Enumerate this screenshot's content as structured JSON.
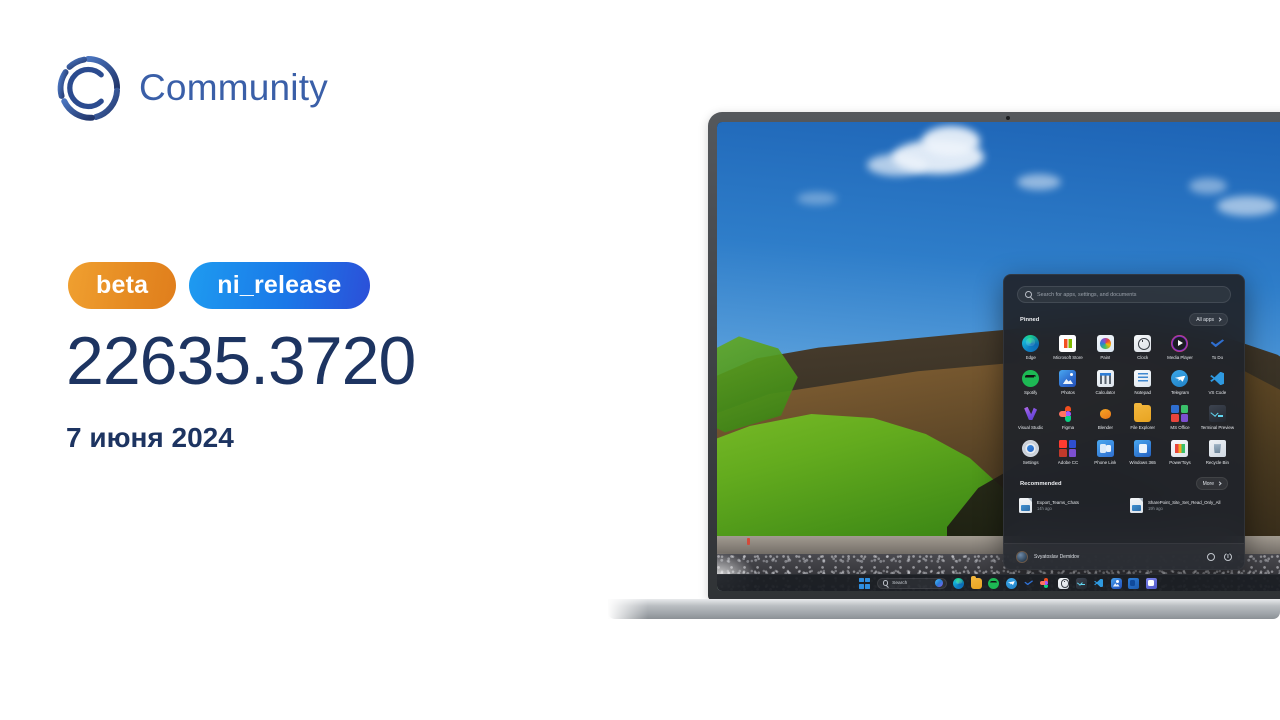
{
  "brand": {
    "name": "Community",
    "mark": "community-logo",
    "color": "#3a5fa8"
  },
  "release": {
    "badges": [
      {
        "label": "beta",
        "kind": "ring",
        "color": "#e58a22"
      },
      {
        "label": "ni_release",
        "kind": "branch",
        "color": "#1a78e8"
      }
    ],
    "build_number": "22635.3720",
    "date": "7 июня 2024",
    "text_color": "#1d3461"
  },
  "start_menu": {
    "search": {
      "placeholder": "Search for apps, settings, and documents",
      "icon": "search-icon"
    },
    "pinned": {
      "title": "Pinned",
      "all_apps_label": "All apps",
      "apps": [
        {
          "label": "Edge",
          "icon": "edge-icon"
        },
        {
          "label": "Microsoft Store",
          "icon": "microsoft-store-icon"
        },
        {
          "label": "Paint",
          "icon": "paint-icon"
        },
        {
          "label": "Clock",
          "icon": "clock-icon"
        },
        {
          "label": "Media Player",
          "icon": "media-player-icon"
        },
        {
          "label": "To Do",
          "icon": "to-do-icon"
        },
        {
          "label": "Spotify",
          "icon": "spotify-icon"
        },
        {
          "label": "Photos",
          "icon": "photos-icon"
        },
        {
          "label": "Calculator",
          "icon": "calculator-icon"
        },
        {
          "label": "Notepad",
          "icon": "notepad-icon"
        },
        {
          "label": "Telegram",
          "icon": "telegram-icon"
        },
        {
          "label": "VS Code",
          "icon": "vs-code-icon"
        },
        {
          "label": "Visual Studio",
          "icon": "visual-studio-icon"
        },
        {
          "label": "Figma",
          "icon": "figma-icon"
        },
        {
          "label": "Blender",
          "icon": "blender-icon"
        },
        {
          "label": "File Explorer",
          "icon": "file-explorer-icon"
        },
        {
          "label": "MS Office",
          "icon": "ms-office-icon"
        },
        {
          "label": "Terminal Preview",
          "icon": "terminal-preview-icon"
        },
        {
          "label": "Settings",
          "icon": "settings-icon"
        },
        {
          "label": "Adobe CC",
          "icon": "adobe-cc-icon"
        },
        {
          "label": "Phone Link",
          "icon": "phone-link-icon"
        },
        {
          "label": "Windows 365",
          "icon": "windows-365-icon"
        },
        {
          "label": "PowerToys",
          "icon": "powertoys-icon"
        },
        {
          "label": "Recycle Bin",
          "icon": "recycle-bin-icon"
        }
      ]
    },
    "recommended": {
      "title": "Recommended",
      "more_label": "More",
      "items": [
        {
          "name": "Export_Teams_Chats",
          "time": "14h ago",
          "icon": "document-icon"
        },
        {
          "name": "SharePoint_Site_Set_Read_Only_All",
          "time": "19h ago",
          "icon": "document-icon"
        }
      ]
    },
    "account": {
      "user_name": "Svyatoslav Demidov",
      "avatar": "user-avatar",
      "settings_icon": "gear-icon",
      "power_icon": "power-icon"
    }
  },
  "taskbar": {
    "start_label": "Start",
    "search_label": "Search",
    "copilot_icon": "copilot-icon",
    "items": [
      {
        "icon": "edge-icon"
      },
      {
        "icon": "file-explorer-icon"
      },
      {
        "icon": "spotify-icon"
      },
      {
        "icon": "telegram-icon"
      },
      {
        "icon": "to-do-icon"
      },
      {
        "icon": "figma-icon"
      },
      {
        "icon": "clock-icon"
      },
      {
        "icon": "terminal-icon"
      },
      {
        "icon": "vs-code-icon"
      },
      {
        "icon": "photos-icon"
      },
      {
        "icon": "outlook-icon"
      },
      {
        "icon": "teams-icon"
      }
    ]
  },
  "wallpaper": {
    "scene": "iceland-cliff-black-beach"
  }
}
